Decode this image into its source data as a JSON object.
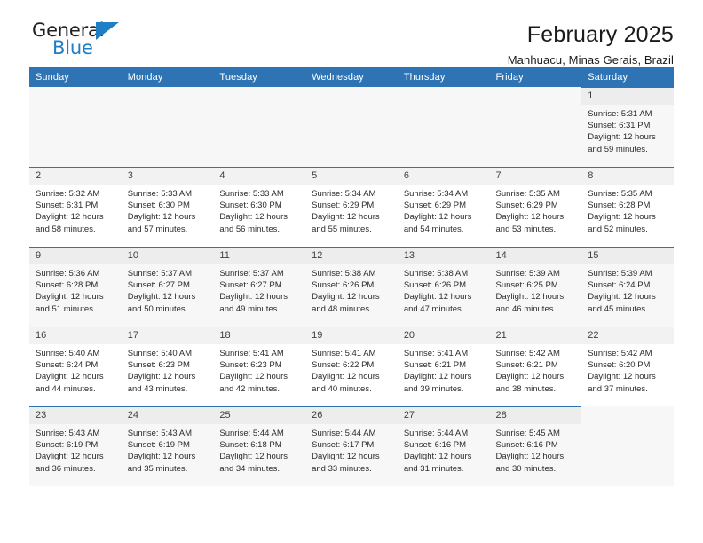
{
  "brand": {
    "name_top": "General",
    "name_bottom": "Blue",
    "triangle_color": "#1f7fc4"
  },
  "header": {
    "title": "February 2025",
    "subtitle": "Manhuacu, Minas Gerais, Brazil"
  },
  "theme": {
    "header_blue": "#2e74b5",
    "daynum_band": "#f2f2f2",
    "row_tint": "#f7f7f7"
  },
  "weekday_headers": [
    "Sunday",
    "Monday",
    "Tuesday",
    "Wednesday",
    "Thursday",
    "Friday",
    "Saturday"
  ],
  "weeks": [
    [
      {
        "day": ""
      },
      {
        "day": ""
      },
      {
        "day": ""
      },
      {
        "day": ""
      },
      {
        "day": ""
      },
      {
        "day": ""
      },
      {
        "day": "1",
        "sunrise": "Sunrise: 5:31 AM",
        "sunset": "Sunset: 6:31 PM",
        "daylight_1": "Daylight: 12 hours",
        "daylight_2": "and 59 minutes."
      }
    ],
    [
      {
        "day": "2",
        "sunrise": "Sunrise: 5:32 AM",
        "sunset": "Sunset: 6:31 PM",
        "daylight_1": "Daylight: 12 hours",
        "daylight_2": "and 58 minutes."
      },
      {
        "day": "3",
        "sunrise": "Sunrise: 5:33 AM",
        "sunset": "Sunset: 6:30 PM",
        "daylight_1": "Daylight: 12 hours",
        "daylight_2": "and 57 minutes."
      },
      {
        "day": "4",
        "sunrise": "Sunrise: 5:33 AM",
        "sunset": "Sunset: 6:30 PM",
        "daylight_1": "Daylight: 12 hours",
        "daylight_2": "and 56 minutes."
      },
      {
        "day": "5",
        "sunrise": "Sunrise: 5:34 AM",
        "sunset": "Sunset: 6:29 PM",
        "daylight_1": "Daylight: 12 hours",
        "daylight_2": "and 55 minutes."
      },
      {
        "day": "6",
        "sunrise": "Sunrise: 5:34 AM",
        "sunset": "Sunset: 6:29 PM",
        "daylight_1": "Daylight: 12 hours",
        "daylight_2": "and 54 minutes."
      },
      {
        "day": "7",
        "sunrise": "Sunrise: 5:35 AM",
        "sunset": "Sunset: 6:29 PM",
        "daylight_1": "Daylight: 12 hours",
        "daylight_2": "and 53 minutes."
      },
      {
        "day": "8",
        "sunrise": "Sunrise: 5:35 AM",
        "sunset": "Sunset: 6:28 PM",
        "daylight_1": "Daylight: 12 hours",
        "daylight_2": "and 52 minutes."
      }
    ],
    [
      {
        "day": "9",
        "sunrise": "Sunrise: 5:36 AM",
        "sunset": "Sunset: 6:28 PM",
        "daylight_1": "Daylight: 12 hours",
        "daylight_2": "and 51 minutes."
      },
      {
        "day": "10",
        "sunrise": "Sunrise: 5:37 AM",
        "sunset": "Sunset: 6:27 PM",
        "daylight_1": "Daylight: 12 hours",
        "daylight_2": "and 50 minutes."
      },
      {
        "day": "11",
        "sunrise": "Sunrise: 5:37 AM",
        "sunset": "Sunset: 6:27 PM",
        "daylight_1": "Daylight: 12 hours",
        "daylight_2": "and 49 minutes."
      },
      {
        "day": "12",
        "sunrise": "Sunrise: 5:38 AM",
        "sunset": "Sunset: 6:26 PM",
        "daylight_1": "Daylight: 12 hours",
        "daylight_2": "and 48 minutes."
      },
      {
        "day": "13",
        "sunrise": "Sunrise: 5:38 AM",
        "sunset": "Sunset: 6:26 PM",
        "daylight_1": "Daylight: 12 hours",
        "daylight_2": "and 47 minutes."
      },
      {
        "day": "14",
        "sunrise": "Sunrise: 5:39 AM",
        "sunset": "Sunset: 6:25 PM",
        "daylight_1": "Daylight: 12 hours",
        "daylight_2": "and 46 minutes."
      },
      {
        "day": "15",
        "sunrise": "Sunrise: 5:39 AM",
        "sunset": "Sunset: 6:24 PM",
        "daylight_1": "Daylight: 12 hours",
        "daylight_2": "and 45 minutes."
      }
    ],
    [
      {
        "day": "16",
        "sunrise": "Sunrise: 5:40 AM",
        "sunset": "Sunset: 6:24 PM",
        "daylight_1": "Daylight: 12 hours",
        "daylight_2": "and 44 minutes."
      },
      {
        "day": "17",
        "sunrise": "Sunrise: 5:40 AM",
        "sunset": "Sunset: 6:23 PM",
        "daylight_1": "Daylight: 12 hours",
        "daylight_2": "and 43 minutes."
      },
      {
        "day": "18",
        "sunrise": "Sunrise: 5:41 AM",
        "sunset": "Sunset: 6:23 PM",
        "daylight_1": "Daylight: 12 hours",
        "daylight_2": "and 42 minutes."
      },
      {
        "day": "19",
        "sunrise": "Sunrise: 5:41 AM",
        "sunset": "Sunset: 6:22 PM",
        "daylight_1": "Daylight: 12 hours",
        "daylight_2": "and 40 minutes."
      },
      {
        "day": "20",
        "sunrise": "Sunrise: 5:41 AM",
        "sunset": "Sunset: 6:21 PM",
        "daylight_1": "Daylight: 12 hours",
        "daylight_2": "and 39 minutes."
      },
      {
        "day": "21",
        "sunrise": "Sunrise: 5:42 AM",
        "sunset": "Sunset: 6:21 PM",
        "daylight_1": "Daylight: 12 hours",
        "daylight_2": "and 38 minutes."
      },
      {
        "day": "22",
        "sunrise": "Sunrise: 5:42 AM",
        "sunset": "Sunset: 6:20 PM",
        "daylight_1": "Daylight: 12 hours",
        "daylight_2": "and 37 minutes."
      }
    ],
    [
      {
        "day": "23",
        "sunrise": "Sunrise: 5:43 AM",
        "sunset": "Sunset: 6:19 PM",
        "daylight_1": "Daylight: 12 hours",
        "daylight_2": "and 36 minutes."
      },
      {
        "day": "24",
        "sunrise": "Sunrise: 5:43 AM",
        "sunset": "Sunset: 6:19 PM",
        "daylight_1": "Daylight: 12 hours",
        "daylight_2": "and 35 minutes."
      },
      {
        "day": "25",
        "sunrise": "Sunrise: 5:44 AM",
        "sunset": "Sunset: 6:18 PM",
        "daylight_1": "Daylight: 12 hours",
        "daylight_2": "and 34 minutes."
      },
      {
        "day": "26",
        "sunrise": "Sunrise: 5:44 AM",
        "sunset": "Sunset: 6:17 PM",
        "daylight_1": "Daylight: 12 hours",
        "daylight_2": "and 33 minutes."
      },
      {
        "day": "27",
        "sunrise": "Sunrise: 5:44 AM",
        "sunset": "Sunset: 6:16 PM",
        "daylight_1": "Daylight: 12 hours",
        "daylight_2": "and 31 minutes."
      },
      {
        "day": "28",
        "sunrise": "Sunrise: 5:45 AM",
        "sunset": "Sunset: 6:16 PM",
        "daylight_1": "Daylight: 12 hours",
        "daylight_2": "and 30 minutes."
      },
      {
        "day": ""
      }
    ]
  ]
}
